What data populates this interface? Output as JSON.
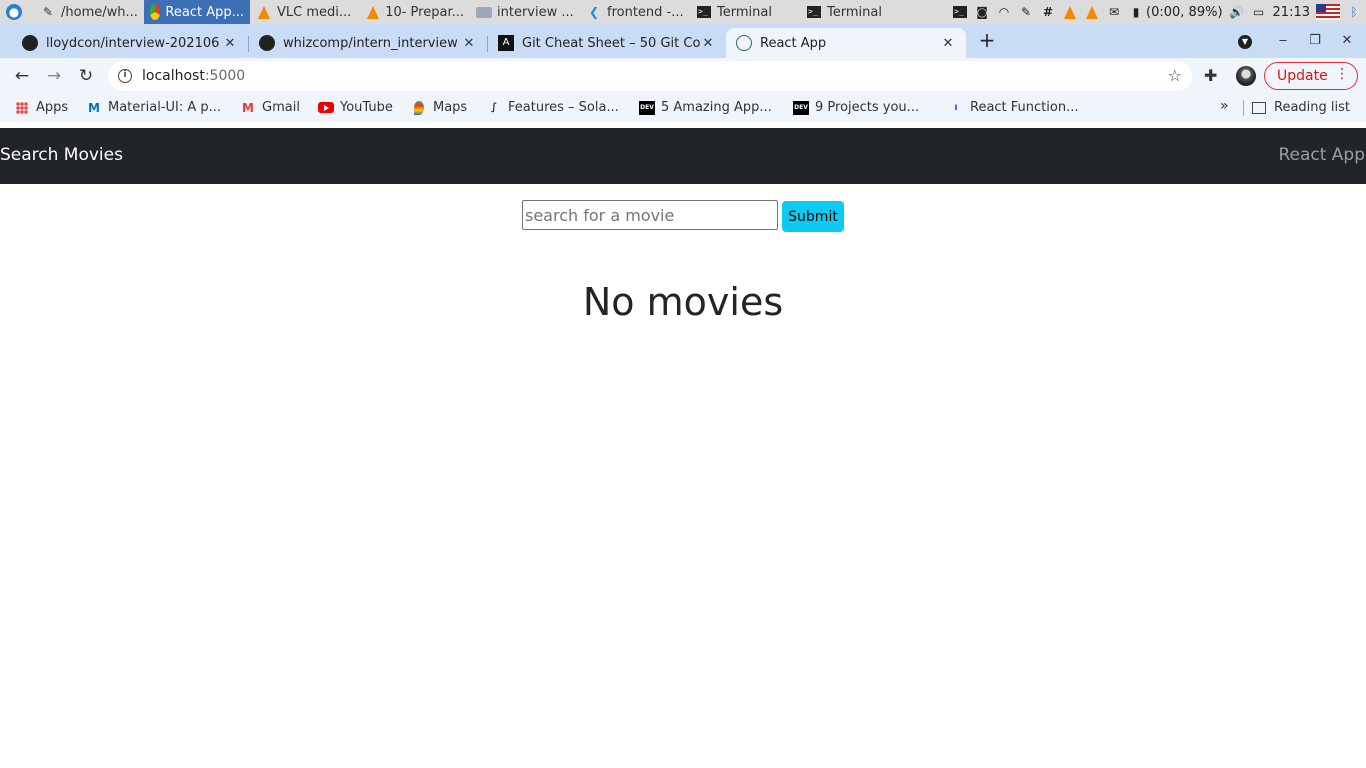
{
  "taskbar": {
    "tasks": [
      {
        "label": "/home/wh...",
        "icon": "text-editor-icon"
      },
      {
        "label": "React App...",
        "icon": "chrome-icon"
      },
      {
        "label": "VLC medi...",
        "icon": "vlc-icon"
      },
      {
        "label": "10- Prepar...",
        "icon": "vlc-icon"
      },
      {
        "label": "interview ...",
        "icon": "folder-icon"
      },
      {
        "label": "frontend -...",
        "icon": "vscode-icon"
      },
      {
        "label": "Terminal",
        "icon": "terminal-icon"
      },
      {
        "label": "Terminal",
        "icon": "terminal-icon"
      }
    ],
    "battery": "(0:00, 89%)",
    "clock": "21:13"
  },
  "tabs": [
    {
      "title": "lloydcon/interview-202106",
      "icon": "github-icon"
    },
    {
      "title": "whizcomp/intern_interview",
      "icon": "github-icon"
    },
    {
      "title": "Git Cheat Sheet – 50 Git Co",
      "icon": "git-cheatsheet-icon"
    },
    {
      "title": "React App",
      "icon": "react-icon",
      "active": true
    }
  ],
  "toolbar": {
    "url_host": "localhost",
    "url_port": ":5000",
    "update_label": "Update"
  },
  "bookmarks": [
    {
      "label": "Apps"
    },
    {
      "label": "Material-UI: A p..."
    },
    {
      "label": "Gmail"
    },
    {
      "label": "YouTube"
    },
    {
      "label": "Maps"
    },
    {
      "label": "Features – Sola..."
    },
    {
      "label": "5 Amazing App..."
    },
    {
      "label": "9 Projects you..."
    },
    {
      "label": "React Function..."
    }
  ],
  "reading_list_label": "Reading list",
  "page": {
    "brand": "Search Movies",
    "nav_link": "React App",
    "search_placeholder": "search for a movie",
    "submit_label": "Submit",
    "empty_message": "No movies"
  },
  "colors": {
    "navbar_bg": "#212529",
    "submit_bg": "#0dcaf0",
    "tabstrip_bg": "#c9dcf6"
  }
}
